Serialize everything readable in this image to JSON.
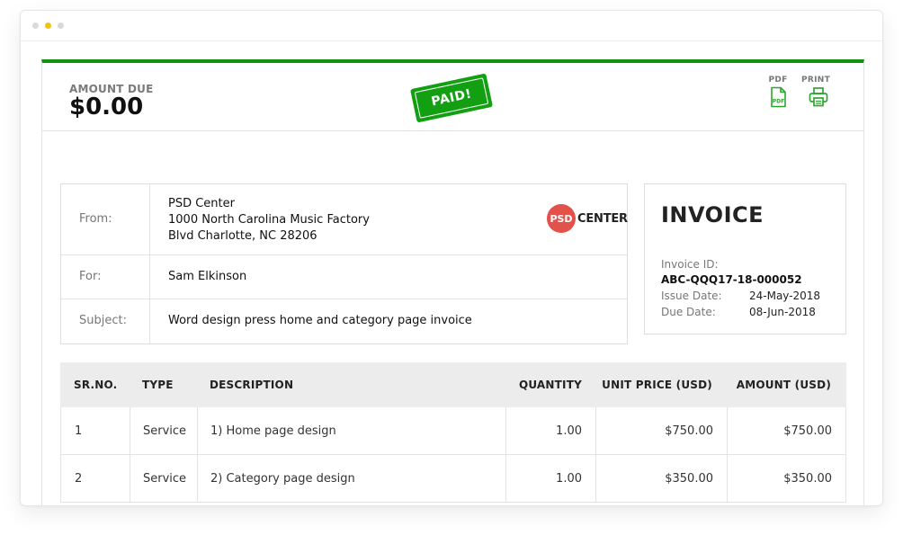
{
  "header": {
    "amount_label": "AMOUNT DUE",
    "amount_value": "$0.00",
    "stamp_text": "PAID!",
    "pdf_label": "PDF",
    "pdf_icon_text": "PDF",
    "print_label": "PRINT"
  },
  "from": {
    "label": "From:",
    "name": "PSD Center",
    "address_line1": "1000 North Carolina Music Factory",
    "address_line2": "Blvd Charlotte, NC 28206"
  },
  "logo": {
    "circle_text": "PSD",
    "text": "CENTER"
  },
  "for": {
    "label": "For:",
    "value": "Sam Elkinson"
  },
  "subject": {
    "label": "Subject:",
    "value": "Word design press home and category page invoice"
  },
  "invoice": {
    "title": "INVOICE",
    "id_label": "Invoice ID:",
    "id_value": "ABC-QQQ17-18-000052",
    "issue_label": "Issue Date:",
    "issue_value": "24-May-2018",
    "due_label": "Due Date:",
    "due_value": "08-Jun-2018"
  },
  "table": {
    "headers": [
      "SR.NO.",
      "TYPE",
      "DESCRIPTION",
      "QUANTITY",
      "UNIT PRICE (USD)",
      "AMOUNT (USD)"
    ],
    "rows": [
      [
        "1",
        "Service",
        "1) Home page design",
        "1.00",
        "$750.00",
        "$750.00"
      ],
      [
        "2",
        "Service",
        "2) Category page design",
        "1.00",
        "$350.00",
        "$350.00"
      ]
    ]
  },
  "colors": {
    "accent_green": "#119311",
    "logo_red": "#e3514b"
  },
  "icons": [
    "pdf-file-icon",
    "printer-icon"
  ]
}
